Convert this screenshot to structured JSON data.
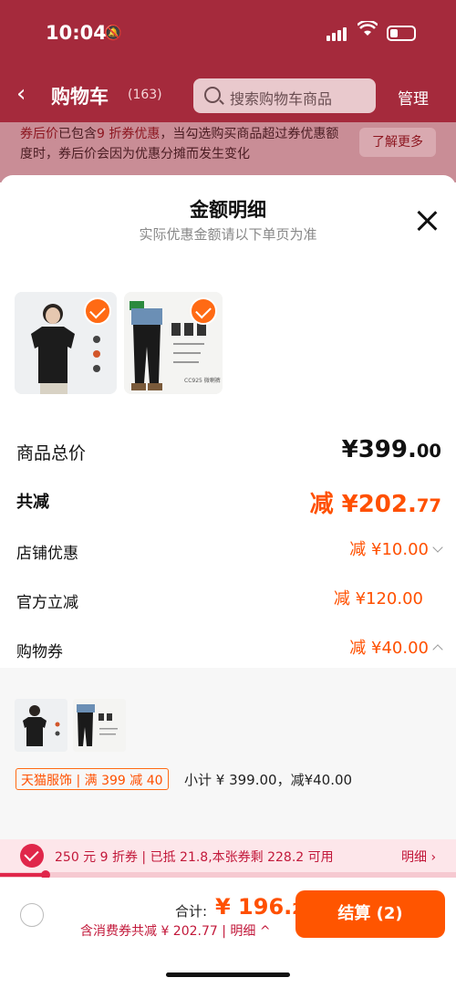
{
  "status_bar": {
    "time": "10:04"
  },
  "nav": {
    "title": "购物车",
    "count": "(163)",
    "search_placeholder": "搜索购物车商品",
    "manage": "管理"
  },
  "notice": {
    "highlight": "券后价",
    "text_a": "已包含",
    "highlight2": "9 折券优惠",
    "text_b": "，当勾选购买商品超过券优惠额度时，券后价会因为优惠分摊而发生变化",
    "button": "了解更多"
  },
  "sheet": {
    "title": "金额明细",
    "subtitle": "实际优惠金额请以下单页为准",
    "rows": [
      {
        "label": "商品总价",
        "value_main": "¥399.",
        "value_cents": "00"
      },
      {
        "label": "共减",
        "value_main": "减 ¥202.",
        "value_cents": "77"
      },
      {
        "label": "店铺优惠",
        "value": "减 ¥10.00"
      },
      {
        "label": "官方立减",
        "value": "减 ¥120.00"
      },
      {
        "label": "购物券",
        "value": "减 ¥40.00"
      }
    ],
    "coupon_tag": "天猫服饰 | 满 399 减 40",
    "subtotal": "小计 ¥ 399.00，减¥40.00",
    "product_text": [
      "CC925 微喇裤",
      "腰下 · 轻量化户外",
      "POLYGIENE 持续抑菌"
    ]
  },
  "promo": {
    "text": "250 元 9 折券 | 已抵 21.8,本张券剩 228.2 可用",
    "detail": "明细 ›",
    "progress": 0.1
  },
  "footer": {
    "total_label": "合计:",
    "total_main": "¥ 196.",
    "total_cents": "23",
    "discount": "含消费券共减 ¥ 202.77 | 明细 ^",
    "checkout": "结算 (2)"
  },
  "colors": {
    "accent": "#ff5000",
    "promo": "#e0264a",
    "header": "#a52a3c"
  }
}
